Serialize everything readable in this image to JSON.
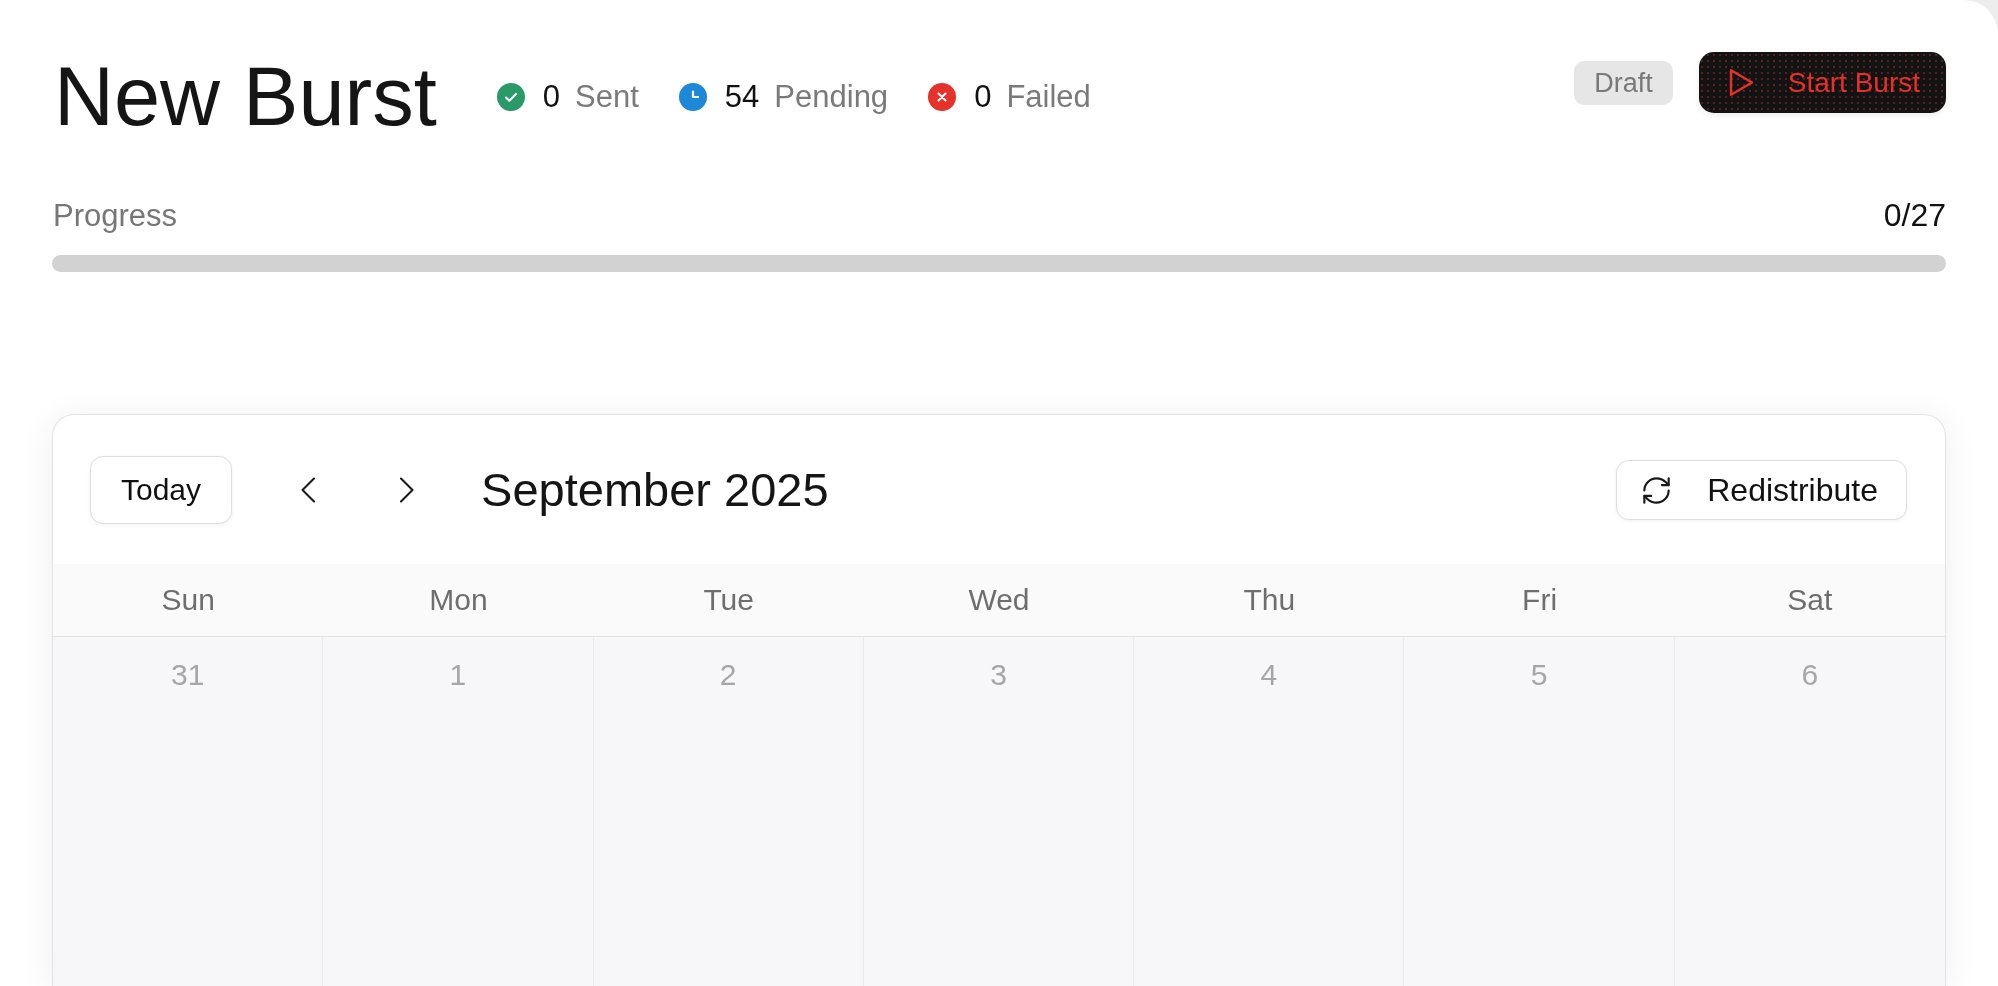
{
  "header": {
    "title": "New Burst",
    "stats": [
      {
        "kind": "check",
        "color": "#2a9a68",
        "count": "0",
        "label": "Sent"
      },
      {
        "kind": "clock",
        "color": "#1d87d8",
        "count": "54",
        "label": "Pending"
      },
      {
        "kind": "cross",
        "color": "#e5322a",
        "count": "0",
        "label": "Failed"
      }
    ],
    "status_badge": "Draft",
    "start_button": "Start Burst"
  },
  "progress": {
    "label": "Progress",
    "reading": "0/27",
    "level": 0
  },
  "calendar": {
    "today_button": "Today",
    "month": "September 2025",
    "redistribute_button": "Redistribute",
    "weekdays": [
      "Sun",
      "Mon",
      "Tue",
      "Wed",
      "Thu",
      "Fri",
      "Sat"
    ],
    "days": [
      "31",
      "1",
      "2",
      "3",
      "4",
      "5",
      "6"
    ]
  }
}
